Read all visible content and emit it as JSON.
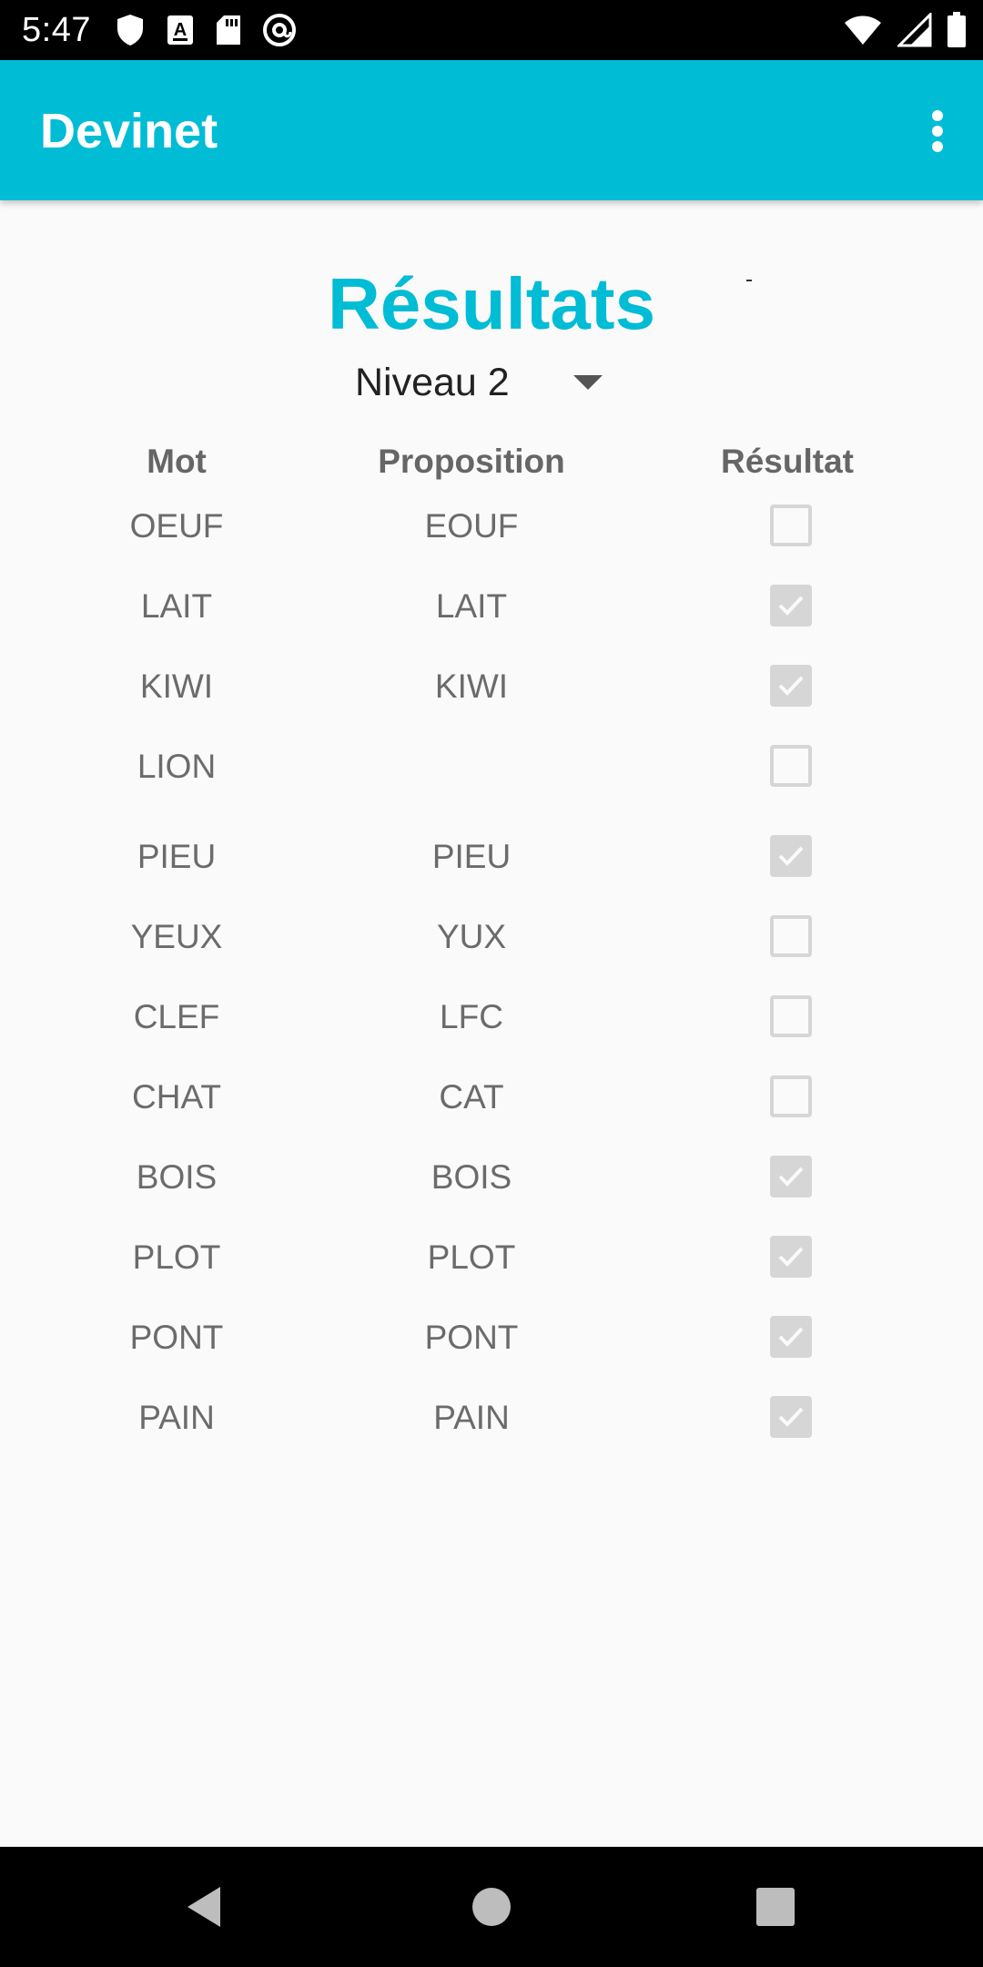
{
  "status_bar": {
    "time": "5:47",
    "left_icons": [
      "shield-icon",
      "a-notification-icon",
      "sd-card-icon",
      "at-sign-icon"
    ],
    "right_icons": [
      "wifi-icon",
      "signal-icon",
      "battery-icon"
    ]
  },
  "app_bar": {
    "title": "Devinet",
    "menu_icon": "more-vert-icon",
    "color": "#00bcd4"
  },
  "heading": "Résultats",
  "level_spinner": {
    "selected": "Niveau 2"
  },
  "table": {
    "headers": [
      "Mot",
      "Proposition",
      "Résultat"
    ],
    "rows": [
      {
        "mot": "OEUF",
        "proposition": "EOUF",
        "correct": false
      },
      {
        "mot": "LAIT",
        "proposition": "LAIT",
        "correct": true
      },
      {
        "mot": "KIWI",
        "proposition": "KIWI",
        "correct": true
      },
      {
        "mot": "LION",
        "proposition": "",
        "correct": false
      },
      {
        "mot": "PIEU",
        "proposition": "PIEU",
        "correct": true
      },
      {
        "mot": "YEUX",
        "proposition": "YUX",
        "correct": false
      },
      {
        "mot": "CLEF",
        "proposition": "LFC",
        "correct": false
      },
      {
        "mot": "CHAT",
        "proposition": "CAT",
        "correct": false
      },
      {
        "mot": "BOIS",
        "proposition": "BOIS",
        "correct": true
      },
      {
        "mot": "PLOT",
        "proposition": "PLOT",
        "correct": true
      },
      {
        "mot": "PONT",
        "proposition": "PONT",
        "correct": true
      },
      {
        "mot": "PAIN",
        "proposition": "PAIN",
        "correct": true
      }
    ]
  },
  "nav_bar": {
    "buttons": [
      "back-icon",
      "home-icon",
      "recents-icon"
    ]
  }
}
